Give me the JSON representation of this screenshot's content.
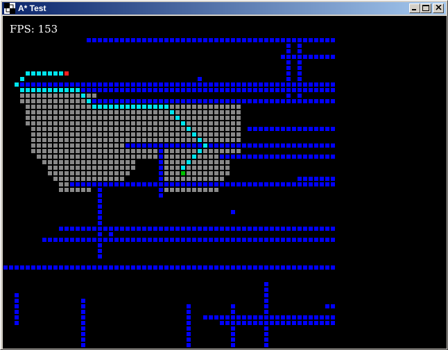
{
  "window": {
    "title": "A* Test",
    "buttons": {
      "minimize": "_",
      "maximize": "□",
      "close": "×"
    }
  },
  "hud": {
    "fps": "FPS: 153"
  },
  "colors": {
    "wall": "#0000ff",
    "closed": "#888888",
    "path": "#00e5ee",
    "start": "#00c000",
    "goal": "#ff2020",
    "background": "#000000"
  }
}
